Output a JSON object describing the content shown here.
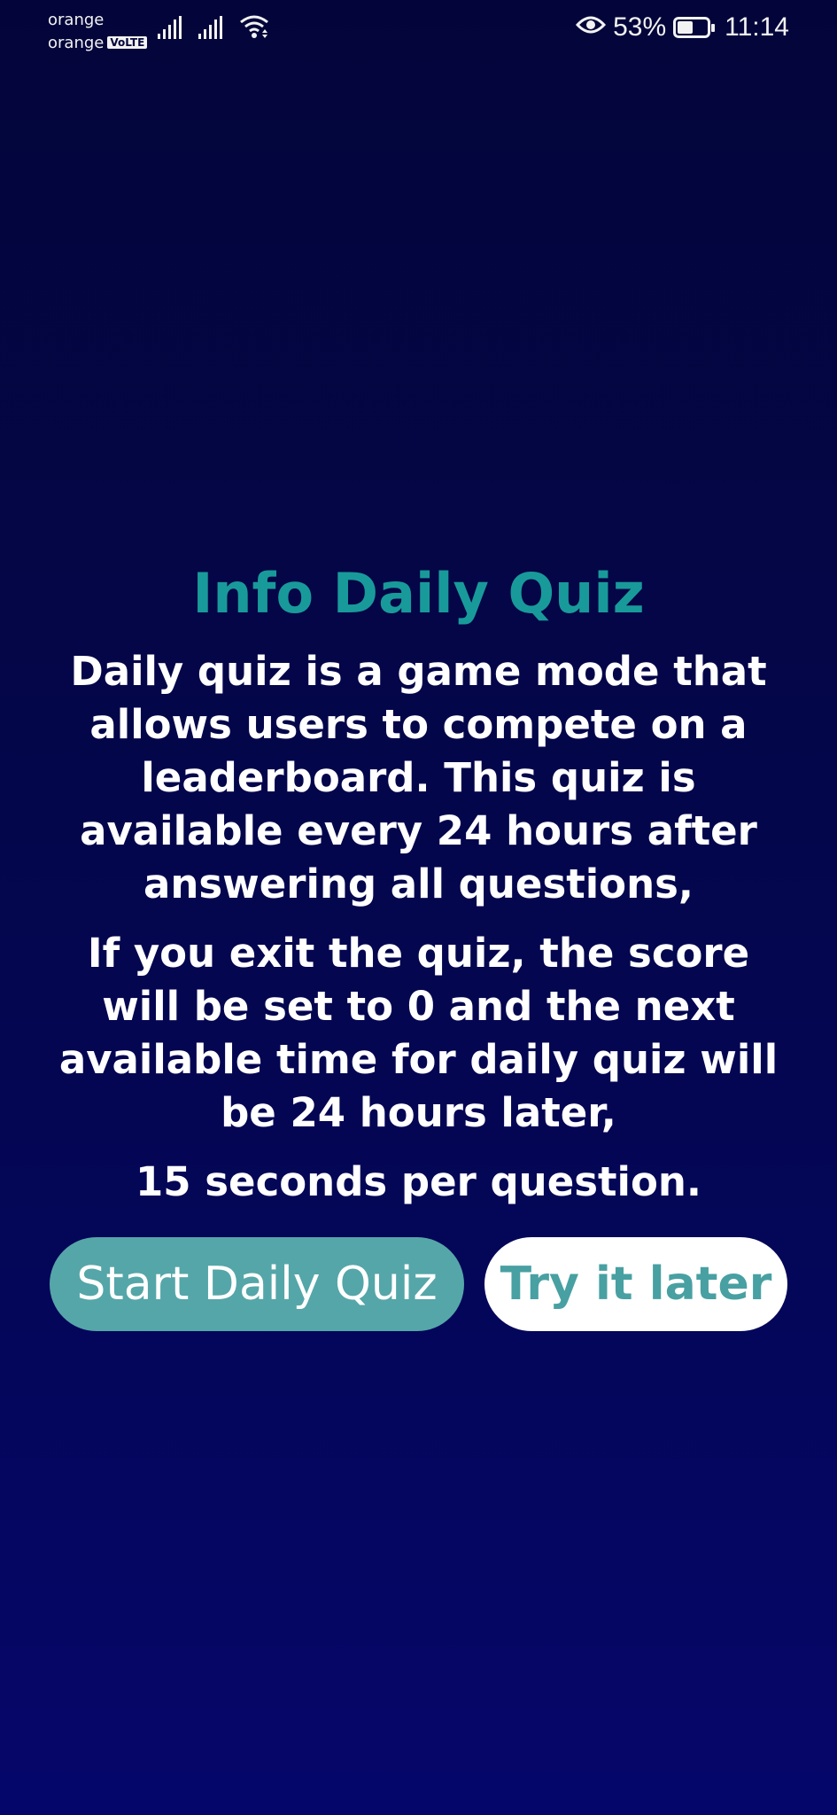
{
  "status_bar": {
    "carrier_1": "orange",
    "carrier_2": "orange",
    "volte_badge": "VoLTE",
    "battery_percent": "53%",
    "battery_level": 0.53,
    "time": "11:14",
    "icons": [
      "signal-icon",
      "signal-icon",
      "wifi-icon",
      "eye-icon",
      "battery-icon"
    ]
  },
  "info": {
    "title": "Info Daily Quiz",
    "paragraph_1": "Daily quiz is a game mode that allows users to compete on a leaderboard. This quiz is available every 24 hours after answering all questions,",
    "paragraph_2": "If you exit the quiz, the score will be set to 0 and the next available time for daily quiz will be 24 hours later,",
    "paragraph_3": "15 seconds per question."
  },
  "actions": {
    "start_label": "Start Daily Quiz",
    "later_label": "Try it later"
  },
  "colors": {
    "background_top": "#03053a",
    "background_bottom": "#05066a",
    "title": "#199a9a",
    "start_button": "#55a6a8",
    "later_button_text": "#48a0a2"
  }
}
